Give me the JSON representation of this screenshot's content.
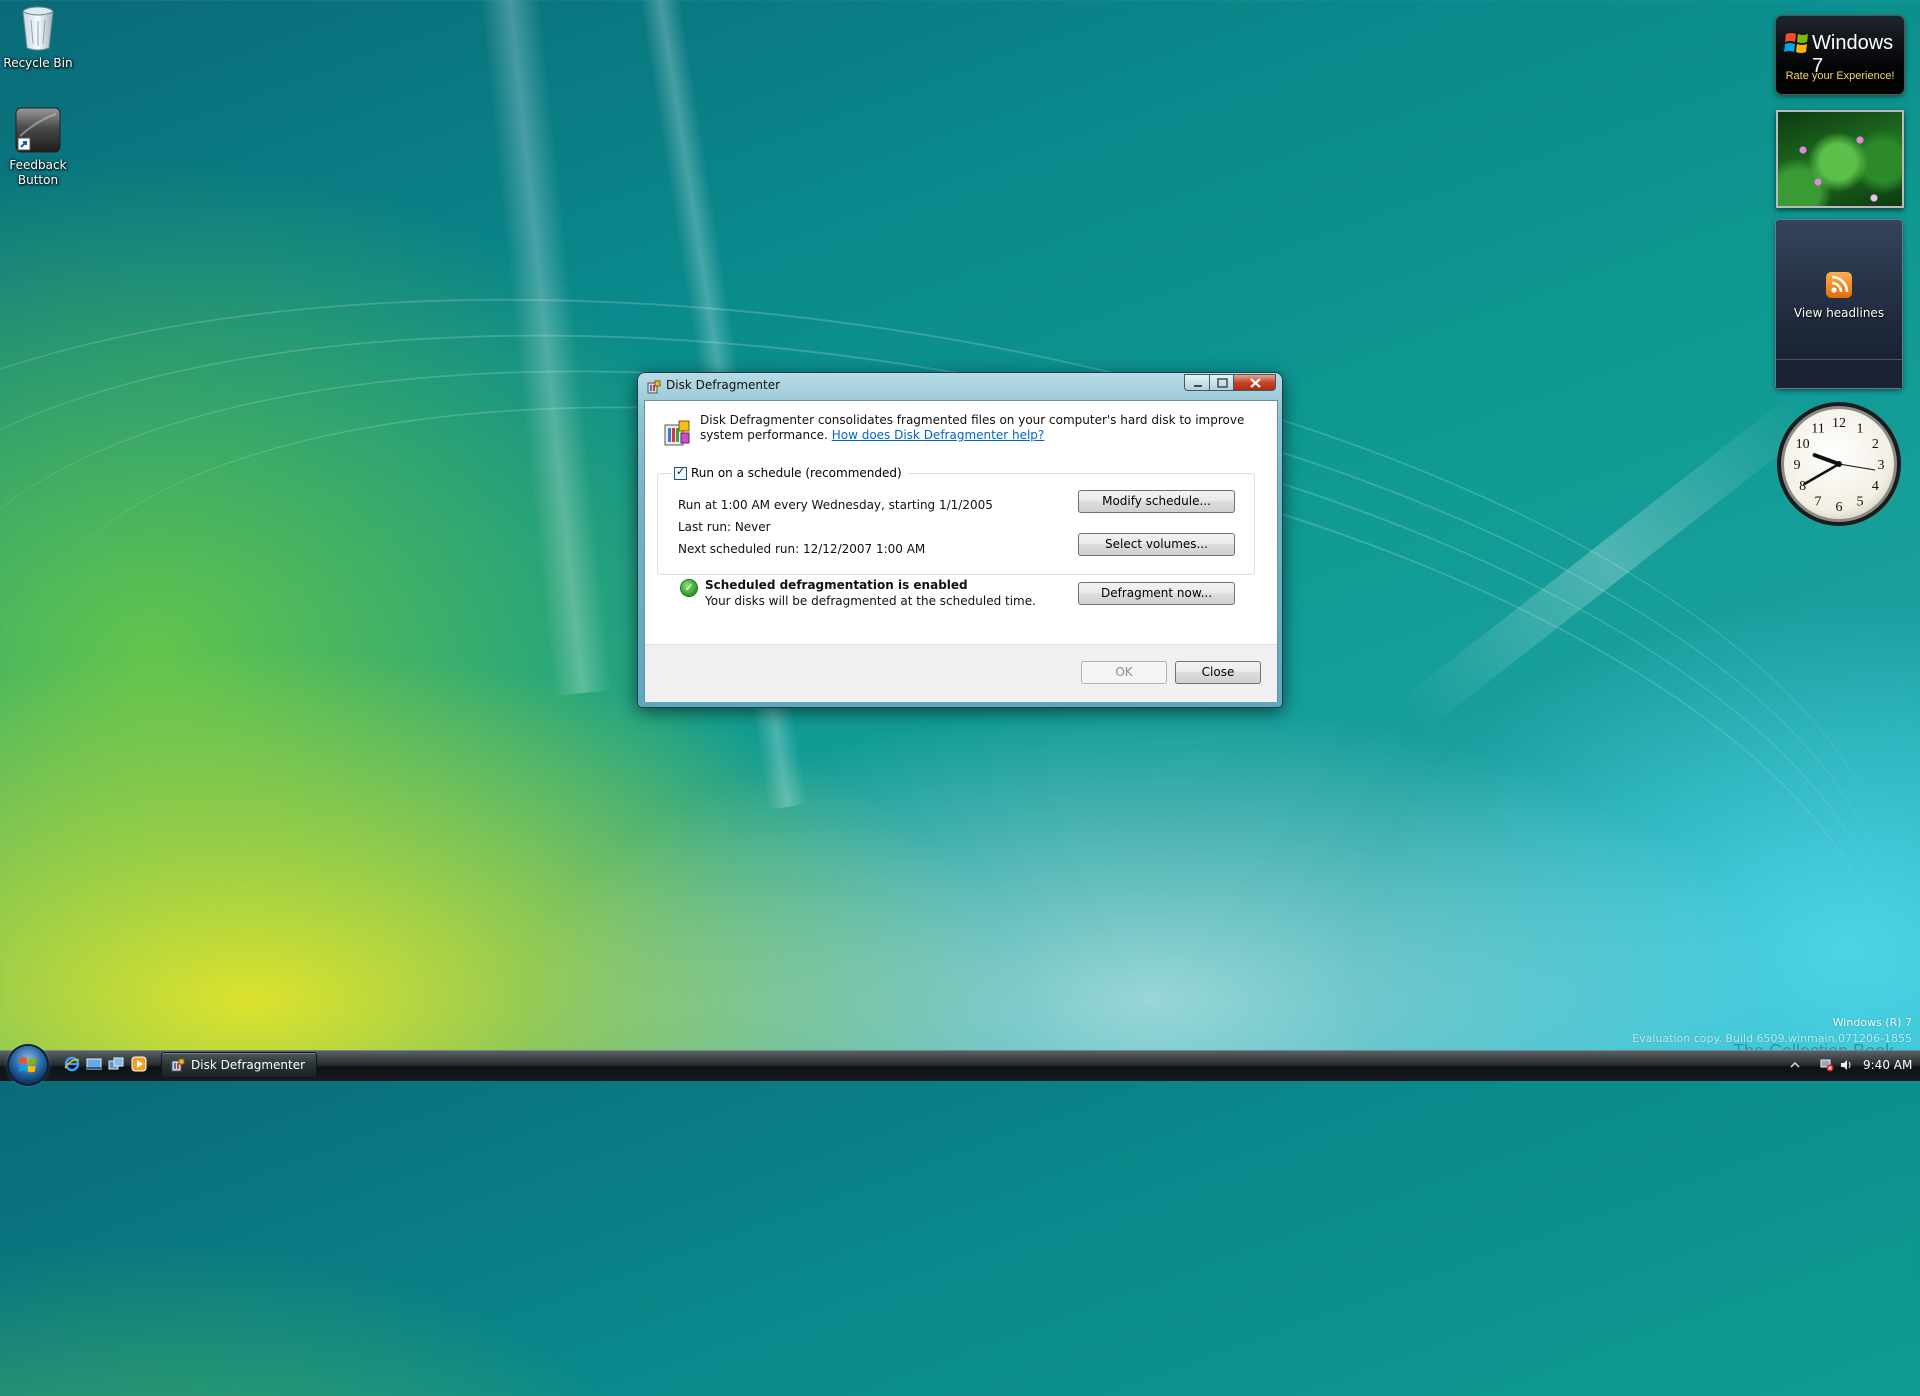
{
  "desktop": {
    "icons": [
      {
        "label": "Recycle Bin",
        "icon": "recycle-bin-icon"
      },
      {
        "label": "Feedback\nButton",
        "icon": "feedback-shortcut-icon"
      }
    ]
  },
  "gadgets": {
    "win7": {
      "title": "Windows 7",
      "subtitle": "Rate your Experience!"
    },
    "feed": {
      "label": "View headlines",
      "icon": "rss-icon"
    },
    "clock": {
      "numbers": [
        "12",
        "1",
        "2",
        "3",
        "4",
        "5",
        "6",
        "7",
        "8",
        "9",
        "10",
        "11"
      ],
      "time": "9:40"
    }
  },
  "dialog": {
    "title": "Disk Defragmenter",
    "intro": "Disk Defragmenter consolidates fragmented files on your computer's hard disk to improve system performance.",
    "help_link": "How does Disk Defragmenter help?",
    "schedule_checkbox": {
      "label": "Run on a schedule (recommended)",
      "checked": true
    },
    "schedule_line": "Run at 1:00 AM every Wednesday, starting 1/1/2005",
    "last_run": "Last run: Never",
    "next_run": "Next scheduled run: 12/12/2007 1:00 AM",
    "modify_button": "Modify schedule...",
    "select_button": "Select volumes...",
    "status_title": "Scheduled defragmentation is enabled",
    "status_sub": "Your disks will be defragmented at the scheduled time.",
    "defrag_button": "Defragment now...",
    "ok_button": "OK",
    "close_button": "Close",
    "colors": {
      "link": "#0066cc",
      "titlebar": "#8fc3d4",
      "close": "#c5452a"
    }
  },
  "taskbar": {
    "task": "Disk Defragmenter",
    "clock": "9:40 AM"
  },
  "watermark": {
    "line1": "Windows (R) 7",
    "line2": "Evaluation copy. Build 6509.winmain.071206-1855",
    "brand": "The Collection Book"
  }
}
